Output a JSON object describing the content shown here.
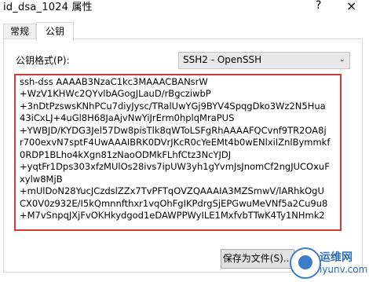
{
  "window": {
    "title": "id_dsa_1024 属性",
    "help": "?",
    "close": "×"
  },
  "tabs": {
    "general": "常规",
    "public_key": "公钥"
  },
  "format": {
    "label": "公钥格式(P):",
    "selected": "SSH2 - OpenSSH"
  },
  "key_lines": [
    "ssh-dss AAAAB3NzaC1kc3MAAACBANsrW",
    "+WzV1KHWc2QYvlbAGogJLauD/rBgcziwbP",
    "+3nDtPzswsKNhPCu7diyJysc/TRalUwYGj9BYV4SpqgDko3Wz2N5Hua",
    "43iCxLJ+4uGl8H68JaAjvNwYiJrErm0hplqMraPUS",
    "+YWBJD/KYDG3Jel57Dw8pisTlk8qWToLSFgRhAAAAFQCvnf9TR2OA8j",
    "r700exvN7sptF4UwAAAIBRK0DVrJKcR0cYeEMt4b0wENlxiIZnlBymmkf",
    "0RDP1BLho4kXgn81zNaoODMkFLhfCtz3NcYJDJ",
    "+yqtFr1Dps303xfzMUlOs28ivs7ipUW3yh1gYvmJsJnomCf2ngJUCOxuF",
    "xylw8MjB",
    "+mUlDoN28YucJCzdslZZx7TvPFTqOVZQAAAIA3MZSmwV/lARhkOgU",
    "CX0V0z932E/I5kQmnnfthxr1vqOhFgIKPdrgSjEPGwuMeVNf5a2Cu9u8",
    "+M7vSnpqJXjFvOKHkydgod1eDAWPPWyILE1MxfvbTTwK4Ty1NHmk2"
  ],
  "save_button": "保存为文件(S)...",
  "watermark": {
    "line1": "运维网",
    "line2": "iyunv.com"
  },
  "colors": {
    "highlight_border": "#d23a3a",
    "watermark": "#2d6fb8"
  }
}
